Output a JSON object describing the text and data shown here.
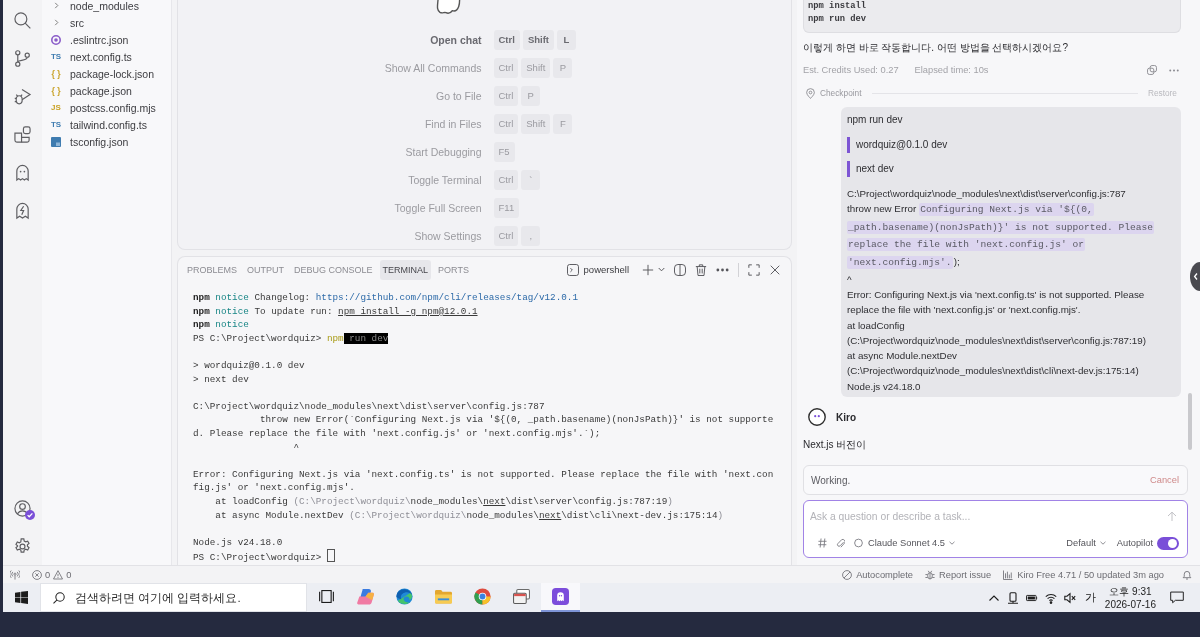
{
  "activity_bar": {
    "top": [
      {
        "kind": "search"
      },
      {
        "kind": "source_control"
      },
      {
        "kind": "run_debug"
      },
      {
        "kind": "extensions"
      },
      {
        "kind": "ghost"
      },
      {
        "kind": "ghost_bolt"
      }
    ],
    "bottom": [
      {
        "kind": "account"
      },
      {
        "kind": "settings"
      }
    ],
    "account_badge": true
  },
  "explorer": {
    "items": [
      {
        "kind": "folder",
        "name": "node_modules",
        "expanded": false
      },
      {
        "kind": "folder",
        "name": "src",
        "expanded": false
      },
      {
        "kind": "eslint",
        "name": ".eslintrc.json"
      },
      {
        "kind": "ts",
        "glyph": "TS",
        "name": "next.config.ts"
      },
      {
        "kind": "json",
        "glyph": "{ }",
        "name": "package-lock.json"
      },
      {
        "kind": "json",
        "glyph": "{ }",
        "name": "package.json"
      },
      {
        "kind": "js",
        "glyph": "JS",
        "name": "postcss.config.mjs"
      },
      {
        "kind": "ts",
        "glyph": "TS",
        "name": "tailwind.config.ts"
      },
      {
        "kind": "tsconfig",
        "name": "tsconfig.json"
      }
    ]
  },
  "welcome": {
    "shortcuts": [
      {
        "label": "Open chat",
        "keys": [
          "Ctrl",
          "Shift",
          "L"
        ],
        "emphasized": true
      },
      {
        "label": "Show All Commands",
        "keys": [
          "Ctrl",
          "Shift",
          "P"
        ],
        "emphasized": false
      },
      {
        "label": "Go to File",
        "keys": [
          "Ctrl",
          "P"
        ],
        "emphasized": false
      },
      {
        "label": "Find in Files",
        "keys": [
          "Ctrl",
          "Shift",
          "F"
        ],
        "emphasized": false
      },
      {
        "label": "Start Debugging",
        "keys": [
          "F5"
        ],
        "emphasized": false
      },
      {
        "label": "Toggle Terminal",
        "keys": [
          "Ctrl",
          "`"
        ],
        "emphasized": false
      },
      {
        "label": "Toggle Full Screen",
        "keys": [
          "F11"
        ],
        "emphasized": false
      },
      {
        "label": "Show Settings",
        "keys": [
          "Ctrl",
          ","
        ],
        "emphasized": false
      }
    ]
  },
  "panel": {
    "tabs": [
      {
        "label": "PROBLEMS",
        "selected": false
      },
      {
        "label": "OUTPUT",
        "selected": false
      },
      {
        "label": "DEBUG CONSOLE",
        "selected": false
      },
      {
        "label": "TERMINAL",
        "selected": true
      },
      {
        "label": "PORTS",
        "selected": false
      }
    ],
    "terminal_name": "powershell",
    "terminal": {
      "cursor": true,
      "lines": [
        {
          "kind": "text",
          "segments": [
            {
              "kind": "bold",
              "text": "npm"
            },
            {
              "kind": "notice",
              "text": " notice"
            },
            {
              "kind": "plain",
              "text": " Changelog: "
            },
            {
              "kind": "link",
              "text": "https://github.com/npm/cli/releases/tag/v12.0.1"
            }
          ]
        },
        {
          "kind": "text",
          "segments": [
            {
              "kind": "bold",
              "text": "npm"
            },
            {
              "kind": "notice",
              "text": " notice"
            },
            {
              "kind": "plain",
              "text": " To update run: "
            },
            {
              "kind": "underline",
              "text": "npm install -g npm@12.0.1"
            }
          ]
        },
        {
          "kind": "text",
          "segments": [
            {
              "kind": "bold",
              "text": "npm"
            },
            {
              "kind": "notice",
              "text": " notice"
            }
          ]
        },
        {
          "kind": "text",
          "segments": [
            {
              "kind": "plain",
              "text": "PS C:\\Project\\wordquiz> "
            },
            {
              "kind": "command",
              "text": "npm"
            },
            {
              "kind": "selection",
              "text": " run dev"
            }
          ]
        },
        {
          "kind": "blank"
        },
        {
          "kind": "text",
          "segments": [
            {
              "kind": "plain",
              "text": "> wordquiz@0.1.0 dev"
            }
          ]
        },
        {
          "kind": "text",
          "segments": [
            {
              "kind": "plain",
              "text": "> next dev"
            }
          ]
        },
        {
          "kind": "blank"
        },
        {
          "kind": "text",
          "segments": [
            {
              "kind": "plain",
              "text": "C:\\Project\\wordquiz\\node_modules\\next\\dist\\server\\config.js:787"
            }
          ]
        },
        {
          "kind": "text",
          "segments": [
            {
              "kind": "plain",
              "text": "            throw new Error(`Configuring Next.js via '${(0, _path.basename)(nonJsPath)}' is not supporte"
            }
          ]
        },
        {
          "kind": "text",
          "segments": [
            {
              "kind": "plain",
              "text": "d. Please replace the file with 'next.config.js' or 'next.config.mjs'.`);"
            }
          ]
        },
        {
          "kind": "text",
          "segments": [
            {
              "kind": "plain",
              "text": "                  ^"
            }
          ]
        },
        {
          "kind": "blank"
        },
        {
          "kind": "text",
          "segments": [
            {
              "kind": "plain",
              "text": "Error: Configuring Next.js via 'next.config.ts' is not supported. Please replace the file with 'next.con"
            }
          ]
        },
        {
          "kind": "text",
          "segments": [
            {
              "kind": "plain",
              "text": "fig.js' or 'next.config.mjs'."
            }
          ]
        },
        {
          "kind": "text",
          "segments": [
            {
              "kind": "plain",
              "text": "    at loadConfig "
            },
            {
              "kind": "dim",
              "text": "(C:\\Project\\wordquiz\\"
            },
            {
              "kind": "plain",
              "text": "node_modules\\"
            },
            {
              "kind": "underline",
              "text": "next"
            },
            {
              "kind": "plain",
              "text": "\\dist\\server\\config.js:787:19"
            },
            {
              "kind": "dim",
              "text": ")"
            }
          ]
        },
        {
          "kind": "text",
          "segments": [
            {
              "kind": "plain",
              "text": "    at async Module.nextDev "
            },
            {
              "kind": "dim",
              "text": "(C:\\Project\\wordquiz\\"
            },
            {
              "kind": "plain",
              "text": "node_modules\\"
            },
            {
              "kind": "underline",
              "text": "next"
            },
            {
              "kind": "plain",
              "text": "\\dist\\cli\\next-dev.js:175:14"
            },
            {
              "kind": "dim",
              "text": ")"
            }
          ]
        },
        {
          "kind": "blank"
        },
        {
          "kind": "text",
          "segments": [
            {
              "kind": "plain",
              "text": "Node.js v24.18.0"
            }
          ]
        },
        {
          "kind": "text",
          "segments": [
            {
              "kind": "plain",
              "text": "PS C:\\Project\\wordquiz> "
            }
          ]
        }
      ]
    }
  },
  "chat": {
    "code_block": {
      "lines": [
        "npm install",
        "npm run dev"
      ]
    },
    "reply_text": "이렇게 하면 바로 작동합니다. 어떤 방법을 선택하시겠어요?",
    "credits": "Est. Credits Used: 0.27",
    "elapsed": "Elapsed time: 10s",
    "checkpoint": {
      "label": "Checkpoint",
      "action": "Restore"
    },
    "user_message": {
      "blocks": [
        {
          "kind": "text",
          "text": "npm run dev"
        },
        {
          "kind": "quote",
          "text": "wordquiz@0.1.0 dev"
        },
        {
          "kind": "quote",
          "text": "next dev"
        },
        {
          "kind": "paragraph",
          "lines": [
            {
              "kind": "plain",
              "text": "C:\\Project\\wordquiz\\node_modules\\next\\dist\\server\\config.js:787"
            },
            {
              "kind": "mixed",
              "parts": [
                {
                  "kind": "text",
                  "text": "throw new Error"
                },
                {
                  "kind": "code",
                  "text": "Configuring Next.js via '${(0,"
                }
              ]
            },
            {
              "kind": "mixed",
              "parts": [
                {
                  "kind": "code",
                  "text": "_path.basename)(nonJsPath)}' is not supported. Please"
                }
              ]
            },
            {
              "kind": "mixed",
              "parts": [
                {
                  "kind": "code",
                  "text": "replace the file with 'next.config.js' or"
                }
              ]
            },
            {
              "kind": "mixed",
              "parts": [
                {
                  "kind": "code",
                  "text": "'next.config.mjs'."
                },
                {
                  "kind": "text",
                  "text": ");"
                }
              ]
            },
            {
              "kind": "plain",
              "text": "^"
            },
            {
              "kind": "plain",
              "text": "Error: Configuring Next.js via 'next.config.ts' is not supported. Please replace the file with 'next.config.js' or 'next.config.mjs'."
            },
            {
              "kind": "plain",
              "text": "at loadConfig (C:\\Project\\wordquiz\\node_modules\\next\\dist\\server\\config.js:787:19)"
            },
            {
              "kind": "plain",
              "text": "at async Module.nextDev (C:\\Project\\wordquiz\\node_modules\\next\\dist\\cli\\next-dev.js:175:14)"
            },
            {
              "kind": "plain",
              "text": "Node.js v24.18.0"
            }
          ]
        }
      ]
    },
    "agent": {
      "name": "Kiro",
      "text": "Next.js 버전이"
    },
    "status": {
      "label": "Working.",
      "action": "Cancel"
    },
    "composer": {
      "placeholder": "Ask a question or describe a task...",
      "model": "Claude Sonnet 4.5",
      "mode": "Default",
      "autopilot_label": "Autopilot",
      "autopilot": true
    }
  },
  "status_bar": {
    "errors": "0",
    "warnings": "0",
    "items": [
      {
        "kind": "autocomplete",
        "text": "Autocomplete"
      },
      {
        "kind": "report",
        "text": "Report issue"
      },
      {
        "kind": "usage",
        "text": "Kiro Free 4.71 / 50 updated 3m ago"
      }
    ]
  },
  "taskbar": {
    "search_placeholder": "검색하려면 여기에 입력하세요.",
    "apps": [
      {
        "kind": "task_view",
        "selected": false
      },
      {
        "kind": "copilot",
        "selected": false
      },
      {
        "kind": "edge",
        "selected": false
      },
      {
        "kind": "explorer",
        "selected": false
      },
      {
        "kind": "chrome",
        "selected": false
      },
      {
        "kind": "remote",
        "selected": false
      },
      {
        "kind": "kiro",
        "selected": true
      }
    ],
    "ime": "가",
    "time": "오후 9:31",
    "date": "2026-07-16"
  }
}
